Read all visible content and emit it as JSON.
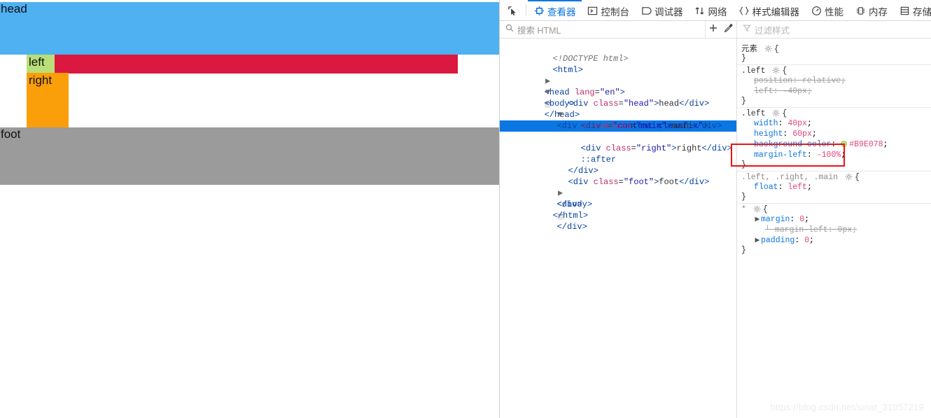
{
  "rendered_page": {
    "head_label": "head",
    "main_label": "",
    "left_label": "left",
    "right_label": "right",
    "foot_label": "foot",
    "colors": {
      "head": "#4FB0F2",
      "main": "#DB1840",
      "left": "#B9E078",
      "right": "#FA9E09",
      "foot": "#9B9B9B"
    }
  },
  "devtools": {
    "tabs": [
      {
        "icon": "picker-arrow-icon",
        "label": "",
        "active": false
      },
      {
        "icon": "inspector-icon",
        "label": "查看器",
        "active": true
      },
      {
        "icon": "console-icon",
        "label": "控制台",
        "active": false
      },
      {
        "icon": "debugger-icon",
        "label": "调试器",
        "active": false
      },
      {
        "icon": "network-icon",
        "label": "网络",
        "active": false
      },
      {
        "icon": "style-editor-icon",
        "label": "样式编辑器",
        "active": false
      },
      {
        "icon": "performance-icon",
        "label": "性能",
        "active": false
      },
      {
        "icon": "memory-icon",
        "label": "内存",
        "active": false
      },
      {
        "icon": "storage-icon",
        "label": "存储",
        "active": false
      },
      {
        "icon": "accessibility-icon",
        "label": "",
        "active": false
      }
    ],
    "search": {
      "icon": "search-icon",
      "placeholder": "搜索 HTML",
      "value": ""
    },
    "search_tools": [
      {
        "icon": "plus-icon",
        "label": "+"
      },
      {
        "icon": "eyedropper-icon",
        "label": ""
      }
    ],
    "filter": {
      "icon": "filter-icon",
      "placeholder": "过滤样式",
      "value": ""
    },
    "markup": {
      "lines": [
        {
          "indent": 0,
          "twisty": "none",
          "type": "doctype",
          "text": "<!DOCTYPE html>"
        },
        {
          "indent": 0,
          "twisty": "none",
          "type": "tag",
          "tag": "html",
          "text": "<html>"
        },
        {
          "indent": 0,
          "twisty": "closed",
          "type": "collapsed",
          "tag": "head",
          "attr_name": "lang",
          "attr_value": "\"en\"",
          "text": "<head lang=\"en\"> … </head>"
        },
        {
          "indent": 0,
          "twisty": "open",
          "type": "tag",
          "tag": "body",
          "text": "<body>"
        },
        {
          "indent": 1,
          "twisty": "none",
          "type": "element",
          "tag": "div",
          "attr_name": "class",
          "attr_value": "\"head\"",
          "inner": "head"
        },
        {
          "indent": 1,
          "twisty": "open",
          "type": "element-open",
          "tag": "div",
          "attr_name": "class",
          "attr_value": "\"content cleanfix\""
        },
        {
          "indent": 2,
          "twisty": "none",
          "type": "element",
          "tag": "div",
          "attr_name": "class",
          "attr_value": "\"main\"",
          "inner": "main"
        },
        {
          "indent": 2,
          "twisty": "none",
          "type": "element",
          "tag": "div",
          "attr_name": "class",
          "attr_value": "\"left\"",
          "inner": "left",
          "selected": true
        },
        {
          "indent": 2,
          "twisty": "none",
          "type": "element",
          "tag": "div",
          "attr_name": "class",
          "attr_value": "\"right\"",
          "inner": "right"
        },
        {
          "indent": 2,
          "twisty": "none",
          "type": "pseudo",
          "text": "::after"
        },
        {
          "indent": 1,
          "twisty": "none",
          "type": "close",
          "text": "</div>"
        },
        {
          "indent": 1,
          "twisty": "none",
          "type": "element",
          "tag": "div",
          "attr_name": "class",
          "attr_value": "\"foot\"",
          "inner": "foot"
        },
        {
          "indent": 1,
          "twisty": "closed",
          "type": "collapsed-plain",
          "tag": "div",
          "text": "<div> … </div>"
        },
        {
          "indent": 0,
          "twisty": "none",
          "type": "close",
          "text": "</body>"
        },
        {
          "indent": 0,
          "twisty": "none",
          "type": "close",
          "text": "</html>"
        }
      ]
    },
    "rules": [
      {
        "selector": "元素",
        "gray_selector": false,
        "declarations": []
      },
      {
        "selector": ".left",
        "gray_selector": false,
        "declarations": [
          {
            "prop": "position",
            "value": "relative",
            "overridden": true
          },
          {
            "prop": "left",
            "value": "-40px",
            "overridden": true
          }
        ]
      },
      {
        "selector": ".left",
        "gray_selector": false,
        "active_marker": true,
        "declarations": [
          {
            "prop": "width",
            "value": "40px",
            "overridden": false
          },
          {
            "prop": "height",
            "value": "60px",
            "overridden": false
          },
          {
            "prop": "background-color",
            "value": "#B9E078",
            "swatch": "#B9E078",
            "overridden": false
          },
          {
            "prop": "margin-left",
            "value": "-100%",
            "overridden": false,
            "highlighted": true
          }
        ]
      },
      {
        "selector": ".left, .right, .main",
        "gray_selector": true,
        "declarations": [
          {
            "prop": "float",
            "value": "left",
            "overridden": false
          }
        ]
      },
      {
        "selector": "*",
        "gray_selector": true,
        "declarations": [
          {
            "prop": "margin",
            "value": "0",
            "expandable": true,
            "overridden": false
          },
          {
            "prop": "margin-left",
            "value": "0px",
            "overridden": true,
            "sub": true
          },
          {
            "prop": "padding",
            "value": "0",
            "expandable": true,
            "overridden": false
          }
        ]
      }
    ],
    "annotation": {
      "name": "red-highlight-box",
      "color": "#EE1111"
    },
    "watermark": "https://blog.csdn.net/sinat_31057219"
  }
}
